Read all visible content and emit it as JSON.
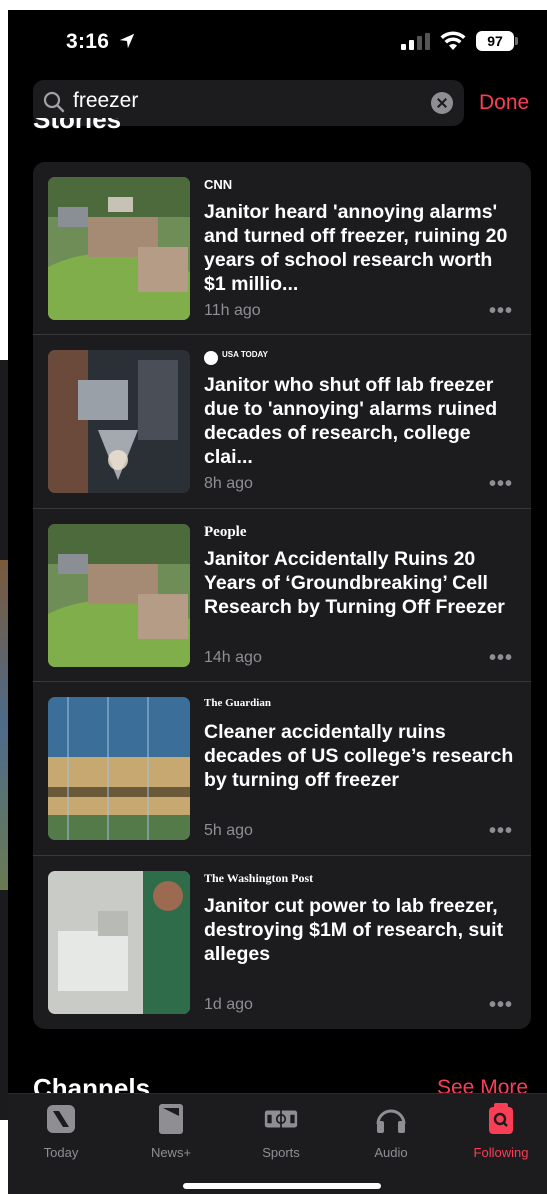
{
  "status_bar": {
    "time": "3:16",
    "battery": "97"
  },
  "search": {
    "value": "freezer",
    "done_label": "Done"
  },
  "sections": {
    "stories_title": "Stories",
    "channels_title": "Channels",
    "see_more": "See More"
  },
  "stories": [
    {
      "publisher": "CNN",
      "headline": "Janitor heard 'annoying alarms' and turned off freezer, ruining 20 years of school research worth $1 millio...",
      "age": "11h ago",
      "more": "•••"
    },
    {
      "publisher": "USA TODAY",
      "headline": "Janitor who shut off lab freezer due to 'annoying' alarms ruined decades of research, college clai...",
      "age": "8h ago",
      "more": "•••"
    },
    {
      "publisher": "People",
      "headline": "Janitor Accidentally Ruins 20 Years of ‘Groundbreaking’ Cell Research by Turning Off Freezer",
      "age": "14h ago",
      "more": "•••"
    },
    {
      "publisher": "The Guardian",
      "headline": "Cleaner accidentally ruins decades of US college’s research by turning off freezer",
      "age": "5h ago",
      "more": "•••"
    },
    {
      "publisher": "The Washington Post",
      "headline": "Janitor cut power to lab freezer, destroying $1M of research, suit alleges",
      "age": "1d ago",
      "more": "•••"
    }
  ],
  "tabs": [
    {
      "label": "Today",
      "icon": "news-icon"
    },
    {
      "label": "News+",
      "icon": "news-plus-icon"
    },
    {
      "label": "Sports",
      "icon": "sports-icon"
    },
    {
      "label": "Audio",
      "icon": "headphones-icon"
    },
    {
      "label": "Following",
      "icon": "following-icon",
      "active": true
    }
  ],
  "colors": {
    "accent": "#fa3e56",
    "card": "#1c1c1e",
    "background": "#000000",
    "secondary_text": "#8e8e93"
  }
}
